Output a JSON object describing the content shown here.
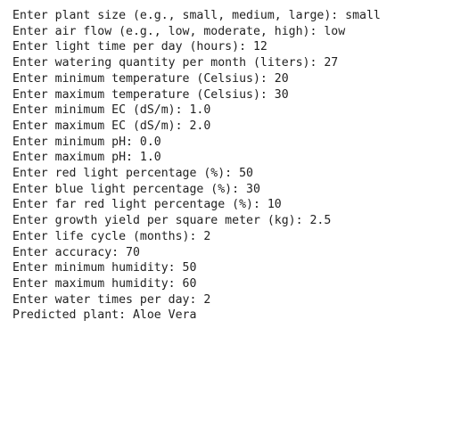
{
  "console": {
    "lines": [
      "Enter plant size (e.g., small, medium, large): small",
      "Enter air flow (e.g., low, moderate, high): low",
      "Enter light time per day (hours): 12",
      "Enter watering quantity per month (liters): 27",
      "Enter minimum temperature (Celsius): 20",
      "Enter maximum temperature (Celsius): 30",
      "Enter minimum EC (dS/m): 1.0",
      "Enter maximum EC (dS/m): 2.0",
      "Enter minimum pH: 0.0",
      "Enter maximum pH: 1.0",
      "Enter red light percentage (%): 50",
      "Enter blue light percentage (%): 30",
      "Enter far red light percentage (%): 10",
      "Enter growth yield per square meter (kg): 2.5",
      "Enter life cycle (months): 2",
      "Enter accuracy: 70",
      "Enter minimum humidity: 50",
      "Enter maximum humidity: 60",
      "Enter water times per day: 2",
      "Predicted plant: Aloe Vera"
    ]
  }
}
